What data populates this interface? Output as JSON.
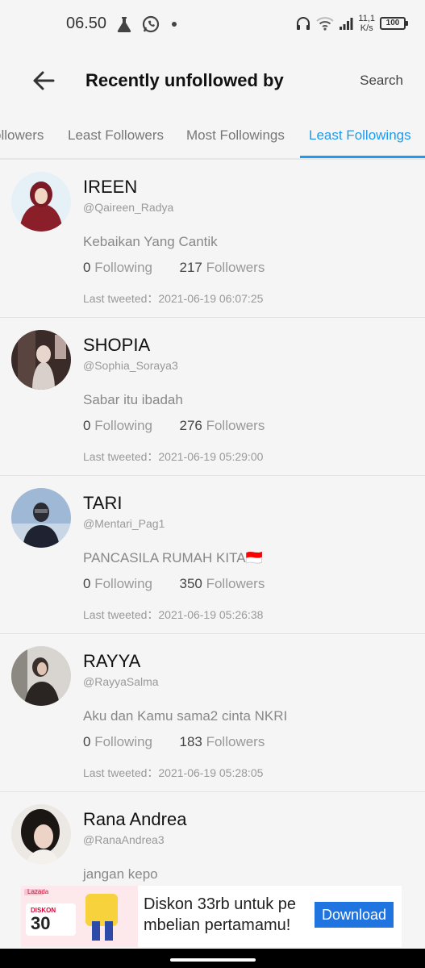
{
  "status_bar": {
    "time": "06.50",
    "net_speed_value": "11,1",
    "net_speed_unit": "K/s",
    "battery": "100",
    "icons": [
      "flask-icon",
      "whatsapp-icon",
      "dot-icon",
      "headphones-icon",
      "wifi-icon",
      "signal-icon",
      "battery-icon"
    ]
  },
  "header": {
    "title": "Recently unfollowed by",
    "search_label": "Search"
  },
  "tabs": [
    {
      "label": "Followers",
      "active": false
    },
    {
      "label": "Least Followers",
      "active": false
    },
    {
      "label": "Most Followings",
      "active": false
    },
    {
      "label": "Least Followings",
      "active": true
    }
  ],
  "tabs_visible_first": "ollowers",
  "labels": {
    "following": "Following",
    "followers": "Followers",
    "last_tweeted": "Last tweeted："
  },
  "users": [
    {
      "name": "IREEN",
      "handle": "@Qaireen_Radya",
      "bio": "Kebaikan Yang Cantik",
      "following": "0",
      "followers": "217",
      "last_tweeted": "2021-06-19 06:07:25"
    },
    {
      "name": "SHOPIA",
      "handle": "@Sophia_Soraya3",
      "bio": "Sabar itu ibadah",
      "following": "0",
      "followers": "276",
      "last_tweeted": "2021-06-19 05:29:00"
    },
    {
      "name": "TARI",
      "handle": "@Mentari_Pag1",
      "bio": "PANCASILA RUMAH KITA🇮🇩",
      "following": "0",
      "followers": "350",
      "last_tweeted": "2021-06-19 05:26:38"
    },
    {
      "name": "RAYYA",
      "handle": "@RayyaSalma",
      "bio": "Aku dan Kamu sama2 cinta NKRI",
      "following": "0",
      "followers": "183",
      "last_tweeted": "2021-06-19 05:28:05"
    },
    {
      "name": "Rana Andrea",
      "handle": "@RanaAndrea3",
      "bio": "jangan kepo",
      "following": "",
      "followers": "",
      "last_tweeted": ""
    }
  ],
  "ad": {
    "text_line1": "Diskon 33rb untuk pe",
    "text_line2": "mbelian pertamamu!",
    "button_label": "Download",
    "brand": "Lazada",
    "badge_label": "DISKON",
    "badge_value": "30",
    "accent_color": "#1f74e0"
  },
  "colors": {
    "accent": "#1d9bf0",
    "background": "#f5f5f5"
  }
}
